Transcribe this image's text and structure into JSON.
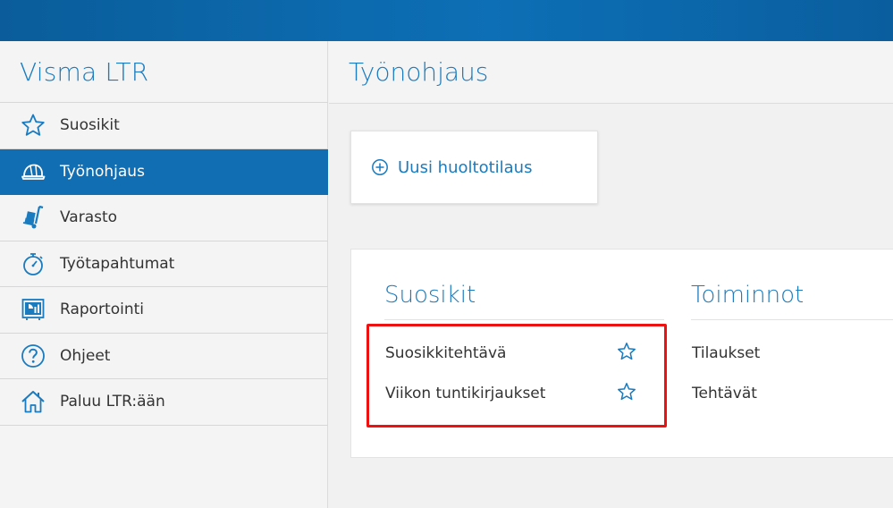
{
  "app": {
    "title": "Visma LTR"
  },
  "sidebar": {
    "items": [
      {
        "label": "Suosikit",
        "icon": "star-icon"
      },
      {
        "label": "Työnohjaus",
        "icon": "hard-hat-icon",
        "active": true
      },
      {
        "label": "Varasto",
        "icon": "hand-truck-icon"
      },
      {
        "label": "Työtapahtumat",
        "icon": "stopwatch-icon"
      },
      {
        "label": "Raportointi",
        "icon": "report-chart-icon"
      },
      {
        "label": "Ohjeet",
        "icon": "help-icon"
      },
      {
        "label": "Paluu LTR:ään",
        "icon": "home-icon"
      }
    ]
  },
  "main": {
    "title": "Työnohjaus",
    "new_order": {
      "label": "Uusi huoltotilaus",
      "icon": "plus-circle-icon"
    },
    "favorites": {
      "title": "Suosikit",
      "items": [
        "Suosikkitehtävä",
        "Viikon tuntikirjaukset"
      ]
    },
    "actions": {
      "title": "Toiminnot",
      "items": [
        "Tilaukset",
        "Tehtävät"
      ]
    }
  },
  "colors": {
    "accent": "#1a7bbf",
    "active_bg": "#116eb2",
    "highlight": "#ee1111",
    "topbar": "#0d6fb6"
  }
}
